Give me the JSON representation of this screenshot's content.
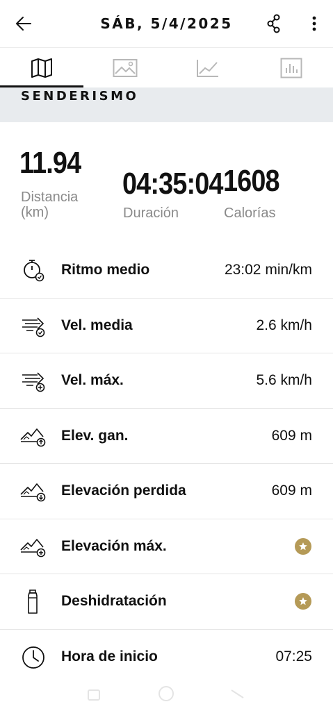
{
  "header": {
    "title": "SÁB, 5/4/2025",
    "back_icon": "back-arrow-icon",
    "share_icon": "share-icon",
    "more_icon": "more-vertical-icon"
  },
  "tabs": [
    {
      "name": "map",
      "icon": "map-icon",
      "active": true
    },
    {
      "name": "photos",
      "icon": "image-icon",
      "active": false
    },
    {
      "name": "graph",
      "icon": "line-chart-icon",
      "active": false
    },
    {
      "name": "bars",
      "icon": "bar-chart-icon",
      "active": false
    }
  ],
  "section": {
    "label": "SENDERISMO"
  },
  "summary": {
    "distance": {
      "value": "11.94",
      "label": "Distancia (km)"
    },
    "duration": {
      "value": "04:35:04",
      "label": "Duración"
    },
    "calories": {
      "value": "1608",
      "label": "Calorías"
    }
  },
  "stats": [
    {
      "label": "Ritmo medio",
      "value": "23:02 min/km",
      "icon": "pace-stopwatch-icon"
    },
    {
      "label": "Vel. media",
      "value": "2.6 km/h",
      "icon": "speed-average-icon"
    },
    {
      "label": "Vel. máx.",
      "value": "5.6 km/h",
      "icon": "speed-max-icon"
    },
    {
      "label": "Elev. gan.",
      "value": "609 m",
      "icon": "elevation-gain-icon"
    },
    {
      "label": "Elevación perdida",
      "value": "609 m",
      "icon": "elevation-loss-icon"
    },
    {
      "label": "Elevación máx.",
      "value": null,
      "premium": true,
      "icon": "elevation-max-icon"
    },
    {
      "label": "Deshidratación",
      "value": null,
      "premium": true,
      "icon": "bottle-icon"
    },
    {
      "label": "Hora de inicio",
      "value": "07:25",
      "icon": "clock-icon"
    }
  ],
  "colors": {
    "accent_gold": "#b59a57",
    "section_band": "#e8ebee",
    "muted_text": "#8a8a8a"
  }
}
